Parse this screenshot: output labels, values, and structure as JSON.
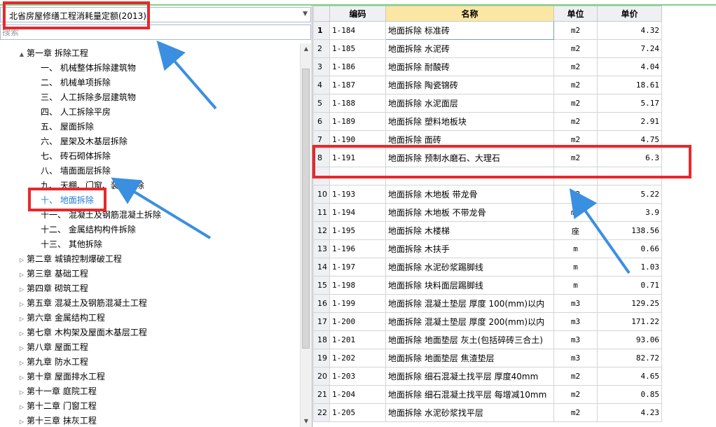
{
  "left_panel": {
    "quota_select": {
      "value": "北省房屋修缮工程消耗量定额(2013)"
    },
    "search": {
      "placeholder": "搜索"
    },
    "tree": [
      {
        "toggle": "▲",
        "label": "第一章 拆除工程",
        "selected": false
      },
      {
        "toggle": "",
        "label": "一、 机械整体拆除建筑物",
        "selected": false
      },
      {
        "toggle": "",
        "label": "二、 机械单项拆除",
        "selected": false
      },
      {
        "toggle": "",
        "label": "三、 人工拆除多层建筑物",
        "selected": false
      },
      {
        "toggle": "",
        "label": "四、 人工拆除平房",
        "selected": false
      },
      {
        "toggle": "",
        "label": "五、 屋面拆除",
        "selected": false
      },
      {
        "toggle": "",
        "label": "六、 屋架及木基层拆除",
        "selected": false
      },
      {
        "toggle": "",
        "label": "七、 砖石砌体拆除",
        "selected": false
      },
      {
        "toggle": "",
        "label": "八、 墙面面层拆除",
        "selected": false
      },
      {
        "toggle": "",
        "label": "九、 天棚、门窗、装修拆除",
        "selected": false
      },
      {
        "toggle": "",
        "label": "十、 地面拆除",
        "selected": true
      },
      {
        "toggle": "",
        "label": "十一、 混凝土及钢筋混凝土拆除",
        "selected": false
      },
      {
        "toggle": "",
        "label": "十二、 金属结构构件拆除",
        "selected": false
      },
      {
        "toggle": "",
        "label": "十三、 其他拆除",
        "selected": false
      },
      {
        "toggle": "▷",
        "label": "第二章 城镇控制爆破工程",
        "selected": false
      },
      {
        "toggle": "▷",
        "label": "第三章 基础工程",
        "selected": false
      },
      {
        "toggle": "▷",
        "label": "第四章 砌筑工程",
        "selected": false
      },
      {
        "toggle": "▷",
        "label": "第五章 混凝土及钢筋混凝土工程",
        "selected": false
      },
      {
        "toggle": "▷",
        "label": "第六章 金属结构工程",
        "selected": false
      },
      {
        "toggle": "▷",
        "label": "第七章 木构架及屋面木基层工程",
        "selected": false
      },
      {
        "toggle": "▷",
        "label": "第八章 屋面工程",
        "selected": false
      },
      {
        "toggle": "▷",
        "label": "第九章 防水工程",
        "selected": false
      },
      {
        "toggle": "▷",
        "label": "第十章 屋面排水工程",
        "selected": false
      },
      {
        "toggle": "▷",
        "label": "第十一章 庭院工程",
        "selected": false
      },
      {
        "toggle": "▷",
        "label": "第十二章 门窗工程",
        "selected": false
      },
      {
        "toggle": "▷",
        "label": "第十三章 抹灰工程",
        "selected": false
      }
    ]
  },
  "grid": {
    "headers": {
      "code": "编码",
      "name": "名称",
      "unit": "单位",
      "price": "单价"
    },
    "rows": [
      {
        "no": "1",
        "code": "1-184",
        "name": "地面拆除 标准砖",
        "unit": "m2",
        "price": "4.32"
      },
      {
        "no": "2",
        "code": "1-185",
        "name": "地面拆除 水泥砖",
        "unit": "m2",
        "price": "7.24"
      },
      {
        "no": "3",
        "code": "1-186",
        "name": "地面拆除 耐酸砖",
        "unit": "m2",
        "price": "4.04"
      },
      {
        "no": "4",
        "code": "1-187",
        "name": "地面拆除 陶瓷锦砖",
        "unit": "m2",
        "price": "18.61"
      },
      {
        "no": "5",
        "code": "1-188",
        "name": "地面拆除 水泥面层",
        "unit": "m2",
        "price": "5.17"
      },
      {
        "no": "6",
        "code": "1-189",
        "name": "地面拆除 塑料地板块",
        "unit": "m2",
        "price": "2.91"
      },
      {
        "no": "7",
        "code": "1-190",
        "name": "地面拆除 面砖",
        "unit": "m2",
        "price": "4.75"
      },
      {
        "no": "8",
        "code": "1-191",
        "name": "地面拆除 预制水磨石、大理石",
        "unit": "m2",
        "price": "6.3"
      },
      {
        "no": "",
        "code": "",
        "name": "",
        "unit": "",
        "price": ""
      },
      {
        "no": "10",
        "code": "1-193",
        "name": "地面拆除 木地板 带龙骨",
        "unit": "m2",
        "price": "5.22"
      },
      {
        "no": "11",
        "code": "1-194",
        "name": "地面拆除 木地板 不带龙骨",
        "unit": "m2",
        "price": "3.9"
      },
      {
        "no": "12",
        "code": "1-195",
        "name": "地面拆除 木楼梯",
        "unit": "座",
        "price": "138.56"
      },
      {
        "no": "13",
        "code": "1-196",
        "name": "地面拆除 木扶手",
        "unit": "m",
        "price": "0.66"
      },
      {
        "no": "14",
        "code": "1-197",
        "name": "地面拆除 水泥砂浆踢脚线",
        "unit": "m",
        "price": "1.03"
      },
      {
        "no": "15",
        "code": "1-198",
        "name": "地面拆除 块料面层踢脚线",
        "unit": "m",
        "price": "0.71"
      },
      {
        "no": "16",
        "code": "1-199",
        "name": "地面拆除 混凝土垫层 厚度 100(mm)以内",
        "unit": "m3",
        "price": "129.25"
      },
      {
        "no": "17",
        "code": "1-200",
        "name": "地面拆除 混凝土垫层 厚度 200(mm)以内",
        "unit": "m3",
        "price": "171.22"
      },
      {
        "no": "18",
        "code": "1-201",
        "name": "地面拆除 地面垫层 灰土(包括碎砖三合土)",
        "unit": "m3",
        "price": "93.06"
      },
      {
        "no": "19",
        "code": "1-202",
        "name": "地面拆除 地面垫层 焦渣垫层",
        "unit": "m3",
        "price": "82.72"
      },
      {
        "no": "20",
        "code": "1-203",
        "name": "地面拆除 细石混凝土找平层 厚度40mm",
        "unit": "m2",
        "price": "4.65"
      },
      {
        "no": "21",
        "code": "1-204",
        "name": "地面拆除 细石混凝土找平层 每增减10mm",
        "unit": "m2",
        "price": "0.85"
      },
      {
        "no": "22",
        "code": "1-205",
        "name": "地面拆除 水泥砂浆找平层",
        "unit": "m2",
        "price": "4.23"
      }
    ]
  },
  "colors": {
    "annotation_red": "#e8282b",
    "annotation_arrow": "#3b8fe0",
    "selected_text": "#1f7ad6",
    "name_header": "#fbe7a3"
  }
}
